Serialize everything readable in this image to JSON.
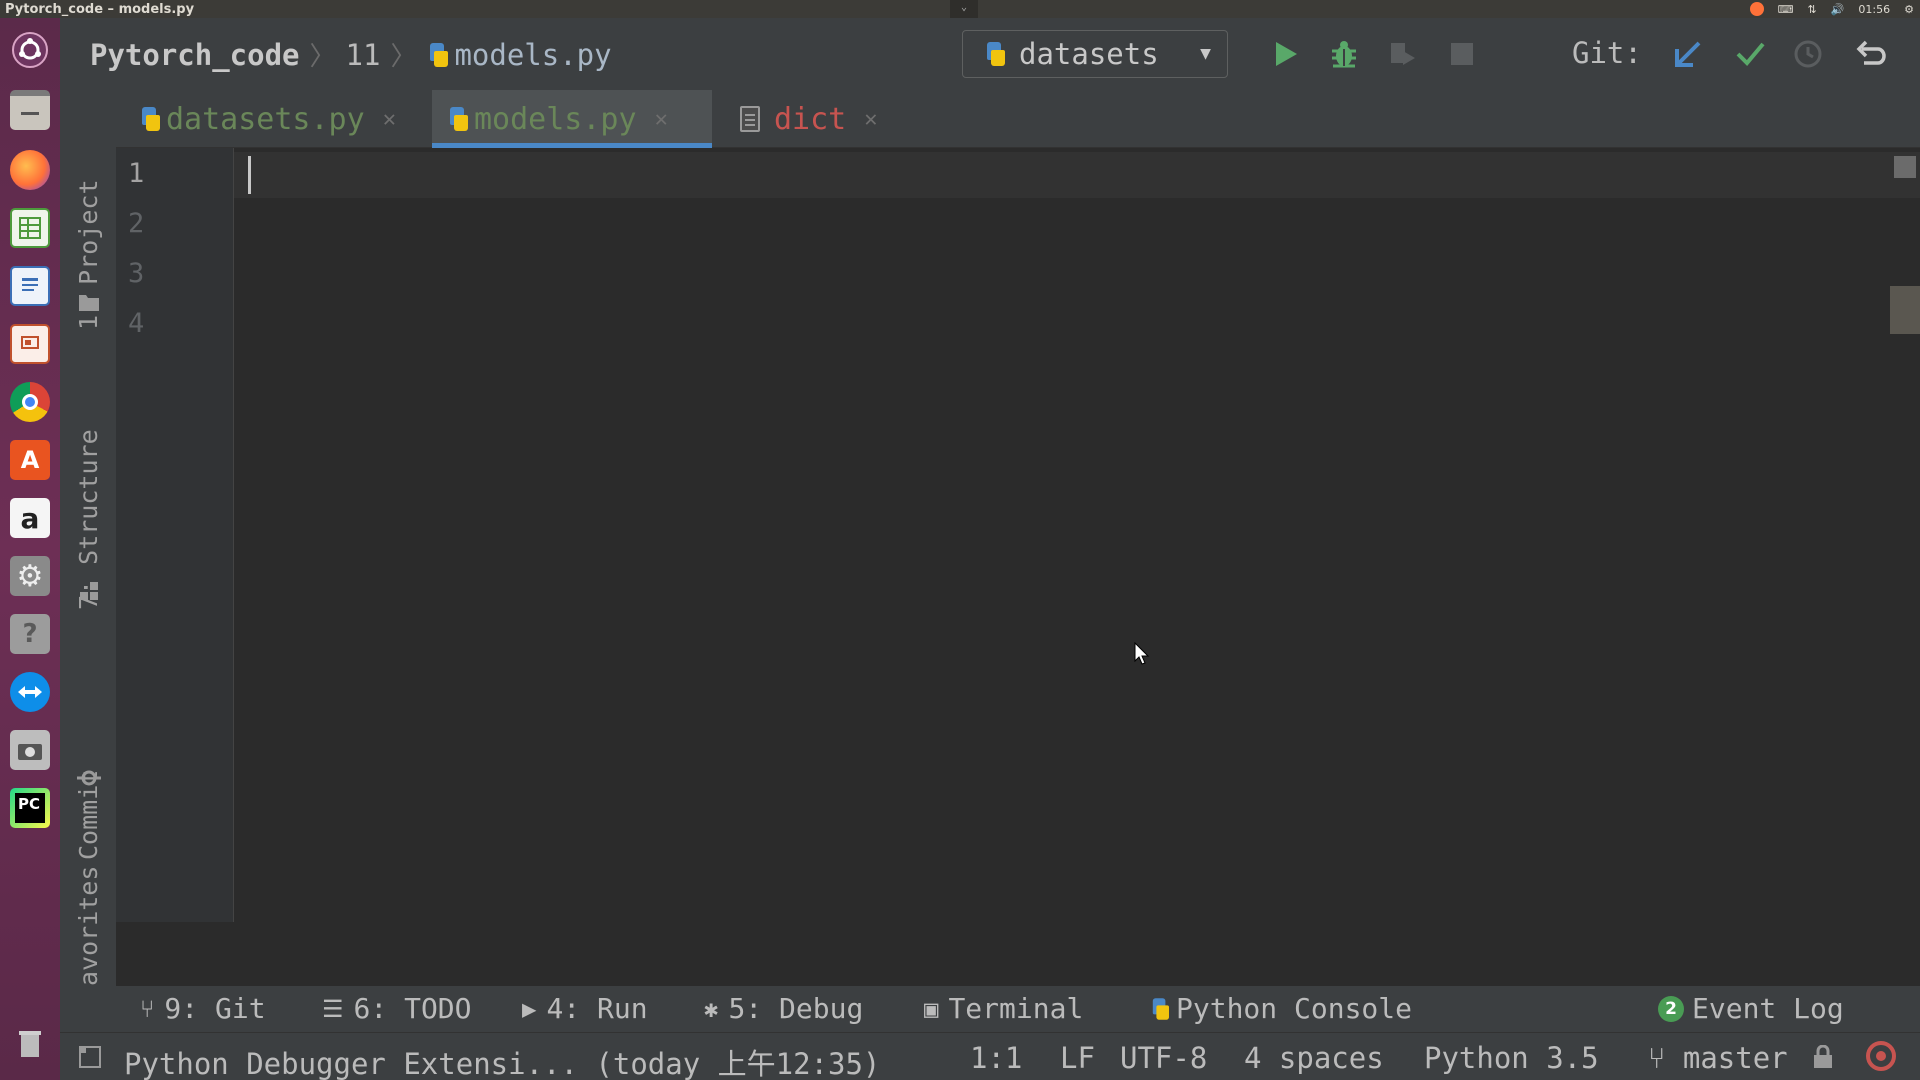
{
  "window": {
    "title": "Pytorch_code – models.py"
  },
  "system": {
    "clock": "01:56"
  },
  "breadcrumb": {
    "project": "Pytorch_code",
    "folder": "11",
    "file": "models.py"
  },
  "run_config": {
    "name": "datasets"
  },
  "vcs": {
    "label": "Git:"
  },
  "tabs": [
    {
      "label": "datasets.py",
      "active": false,
      "color": "#6a8759"
    },
    {
      "label": "models.py",
      "active": true,
      "color": "#6a8759"
    },
    {
      "label": "dict",
      "active": false,
      "color": "#c75450"
    }
  ],
  "side_tools": {
    "project": "1: Project",
    "structure": "7: Structure",
    "commit": "Commit",
    "favorites": "avorites"
  },
  "editor": {
    "line_numbers": [
      "1",
      "2",
      "3",
      "4"
    ],
    "current_line": 1,
    "content": ""
  },
  "bottom_tools": {
    "git": "9: Git",
    "todo": "6: TODO",
    "run": "4: Run",
    "debug": "5: Debug",
    "terminal": "Terminal",
    "python_console": "Python Console",
    "event_log": "Event Log",
    "event_count": "2"
  },
  "status": {
    "message": "Python Debugger Extensi... (today 上午12:35)",
    "position": "1:1",
    "line_sep": "LF",
    "encoding": "UTF-8",
    "indent": "4 spaces",
    "interpreter": "Python 3.5",
    "branch": "master"
  },
  "colors": {
    "accent": "#4a88c7",
    "run_green": "#59a869",
    "editor_bg": "#2b2b2b",
    "panel_bg": "#3c3f41",
    "launcher": "#6d2f55"
  }
}
